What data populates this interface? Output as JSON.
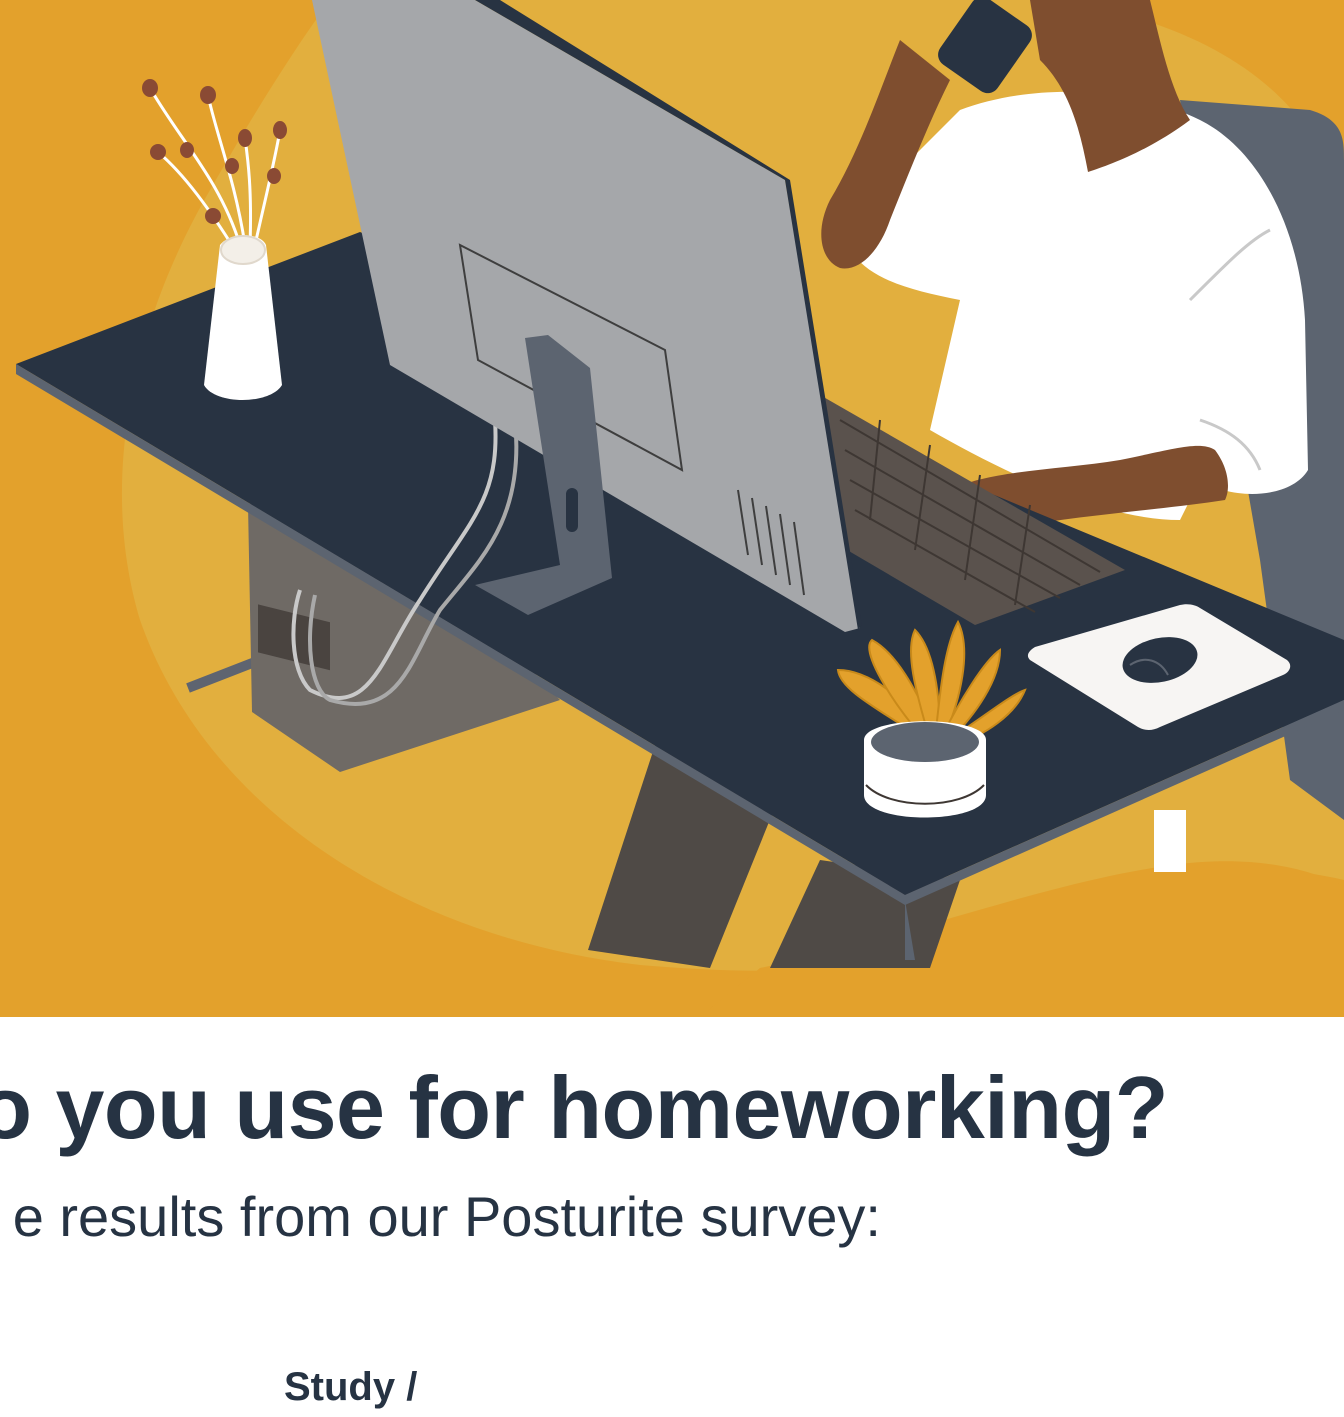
{
  "colors": {
    "background": "#ffffff",
    "illustration_background": "#e3a12c",
    "illustration_blob": "#e2af3e",
    "desk": "#283342",
    "text": "#263343"
  },
  "illustration": {
    "description_icon": "person-working-at-desk-illustration"
  },
  "headline": "o you use for homeworking?",
  "subheadline": "e results from our Posturite survey:",
  "category_label": "Study /"
}
